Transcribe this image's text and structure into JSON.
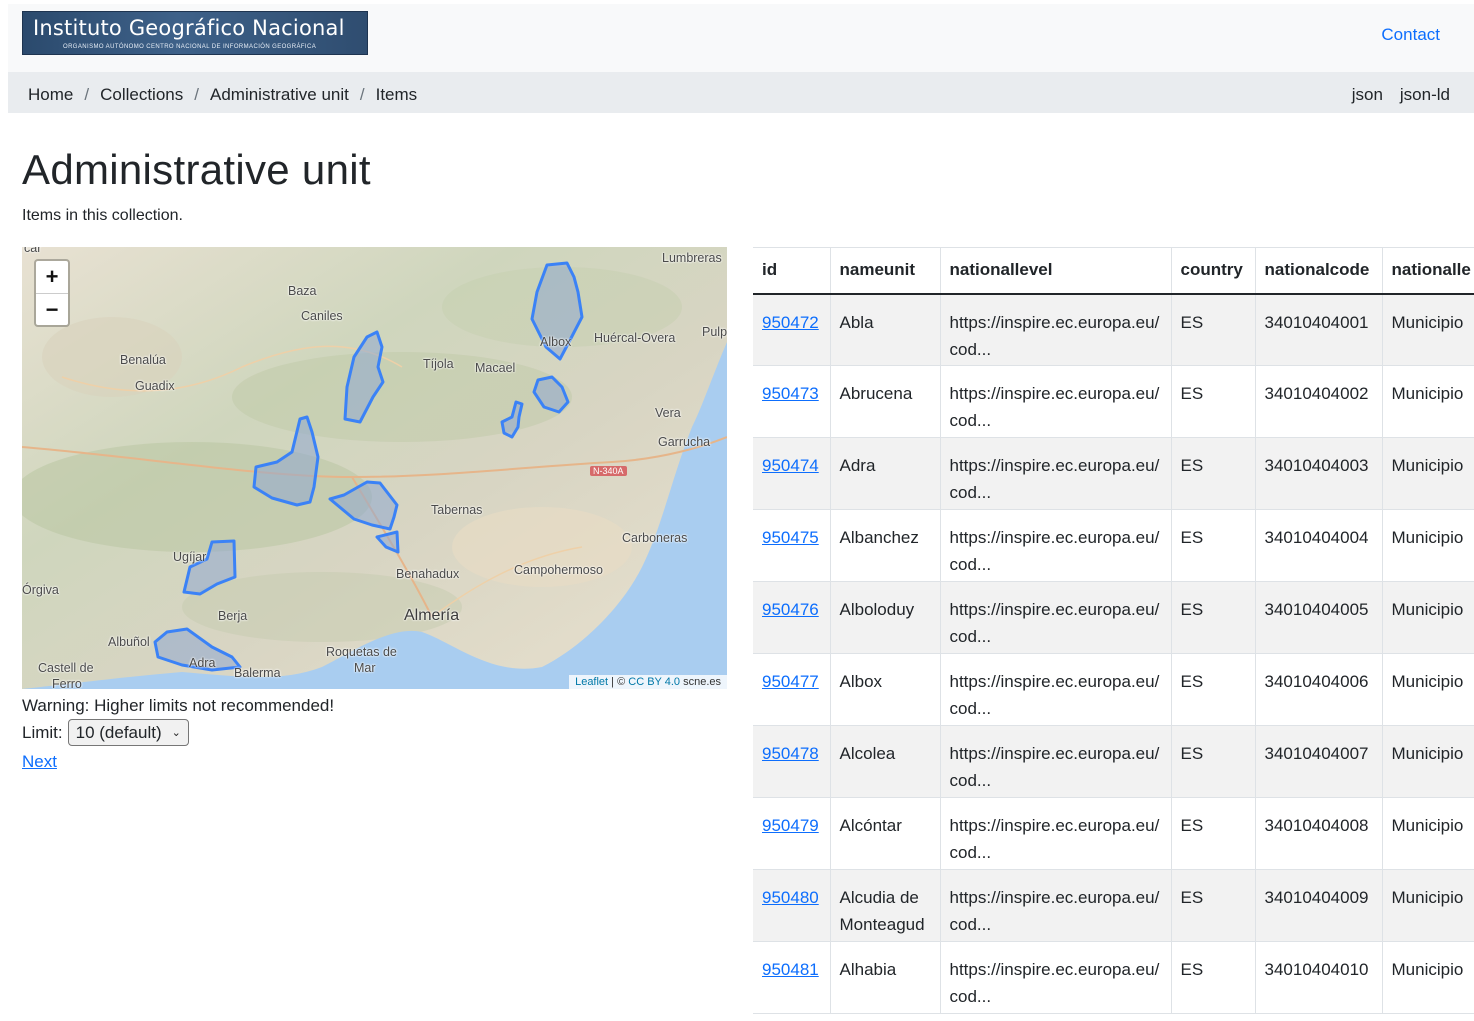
{
  "header": {
    "logo": {
      "main": "Instituto Geográfico Nacional",
      "sub": "Organismo Autónomo    Centro Nacional de Información Geográfica"
    },
    "contact": "Contact"
  },
  "breadcrumb": [
    "Home",
    "Collections",
    "Administrative unit",
    "Items"
  ],
  "formats": [
    "json",
    "json-ld"
  ],
  "page": {
    "title": "Administrative unit",
    "description": "Items in this collection."
  },
  "map": {
    "zoom_in": "+",
    "zoom_out": "−",
    "attribution_leaflet": "Leaflet",
    "attribution_sep": " | © ",
    "attribution_license": "CC BY 4.0",
    "attribution_source": " scne.es",
    "road": "N-340A",
    "places": [
      "Lumbreras",
      "Baza",
      "Caniles",
      "Huércal-Overa",
      "Pulp",
      "Albox",
      "Benalúa",
      "Tíjola",
      "Macael",
      "Guadix",
      "Vera",
      "Garrucha",
      "Tabernas",
      "Carboneras",
      "Ugíjar",
      "Benahadux",
      "Campohermoso",
      "Órgiva",
      "Berja",
      "Almería",
      "Albuñol",
      "Roquetas de",
      "Mar",
      "Castell de",
      "Ferro",
      "Adra",
      "Balerma",
      "car"
    ]
  },
  "controls": {
    "warning": "Warning: Higher limits not recommended!",
    "limit_label": "Limit:",
    "limit_value": "10 (default)",
    "next": "Next"
  },
  "table": {
    "columns": [
      "id",
      "nameunit",
      "nationallevel",
      "country",
      "nationalcode",
      "nationalle"
    ],
    "rows": [
      [
        "950472",
        "Abla",
        "https://inspire.ec.europa.eu/cod...",
        "ES",
        "34010404001",
        "Municipio"
      ],
      [
        "950473",
        "Abrucena",
        "https://inspire.ec.europa.eu/cod...",
        "ES",
        "34010404002",
        "Municipio"
      ],
      [
        "950474",
        "Adra",
        "https://inspire.ec.europa.eu/cod...",
        "ES",
        "34010404003",
        "Municipio"
      ],
      [
        "950475",
        "Albanchez",
        "https://inspire.ec.europa.eu/cod...",
        "ES",
        "34010404004",
        "Municipio"
      ],
      [
        "950476",
        "Alboloduy",
        "https://inspire.ec.europa.eu/cod...",
        "ES",
        "34010404005",
        "Municipio"
      ],
      [
        "950477",
        "Albox",
        "https://inspire.ec.europa.eu/cod...",
        "ES",
        "34010404006",
        "Municipio"
      ],
      [
        "950478",
        "Alcolea",
        "https://inspire.ec.europa.eu/cod...",
        "ES",
        "34010404007",
        "Municipio"
      ],
      [
        "950479",
        "Alcóntar",
        "https://inspire.ec.europa.eu/cod...",
        "ES",
        "34010404008",
        "Municipio"
      ],
      [
        "950480",
        "Alcudia de Monteagud",
        "https://inspire.ec.europa.eu/cod...",
        "ES",
        "34010404009",
        "Municipio"
      ],
      [
        "950481",
        "Alhabia",
        "https://inspire.ec.europa.eu/cod...",
        "ES",
        "34010404010",
        "Municipio"
      ]
    ]
  },
  "colors": {
    "link": "#0d6efd",
    "polygon_stroke": "#3b82f6",
    "sea": "#a9cdf0"
  }
}
